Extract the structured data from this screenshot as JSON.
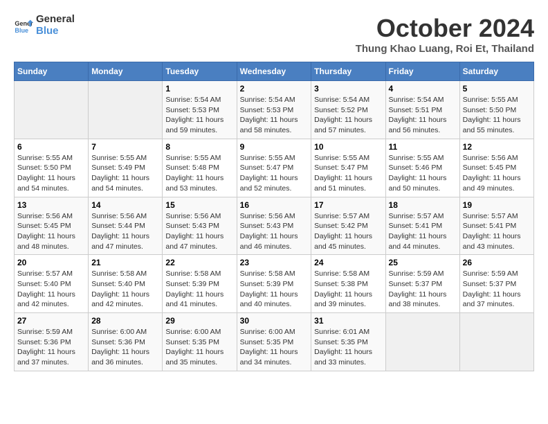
{
  "header": {
    "logo_line1": "General",
    "logo_line2": "Blue",
    "month": "October 2024",
    "location": "Thung Khao Luang, Roi Et, Thailand"
  },
  "weekdays": [
    "Sunday",
    "Monday",
    "Tuesday",
    "Wednesday",
    "Thursday",
    "Friday",
    "Saturday"
  ],
  "weeks": [
    [
      {
        "day": "",
        "info": ""
      },
      {
        "day": "",
        "info": ""
      },
      {
        "day": "1",
        "info": "Sunrise: 5:54 AM\nSunset: 5:53 PM\nDaylight: 11 hours and 59 minutes."
      },
      {
        "day": "2",
        "info": "Sunrise: 5:54 AM\nSunset: 5:53 PM\nDaylight: 11 hours and 58 minutes."
      },
      {
        "day": "3",
        "info": "Sunrise: 5:54 AM\nSunset: 5:52 PM\nDaylight: 11 hours and 57 minutes."
      },
      {
        "day": "4",
        "info": "Sunrise: 5:54 AM\nSunset: 5:51 PM\nDaylight: 11 hours and 56 minutes."
      },
      {
        "day": "5",
        "info": "Sunrise: 5:55 AM\nSunset: 5:50 PM\nDaylight: 11 hours and 55 minutes."
      }
    ],
    [
      {
        "day": "6",
        "info": "Sunrise: 5:55 AM\nSunset: 5:50 PM\nDaylight: 11 hours and 54 minutes."
      },
      {
        "day": "7",
        "info": "Sunrise: 5:55 AM\nSunset: 5:49 PM\nDaylight: 11 hours and 54 minutes."
      },
      {
        "day": "8",
        "info": "Sunrise: 5:55 AM\nSunset: 5:48 PM\nDaylight: 11 hours and 53 minutes."
      },
      {
        "day": "9",
        "info": "Sunrise: 5:55 AM\nSunset: 5:47 PM\nDaylight: 11 hours and 52 minutes."
      },
      {
        "day": "10",
        "info": "Sunrise: 5:55 AM\nSunset: 5:47 PM\nDaylight: 11 hours and 51 minutes."
      },
      {
        "day": "11",
        "info": "Sunrise: 5:55 AM\nSunset: 5:46 PM\nDaylight: 11 hours and 50 minutes."
      },
      {
        "day": "12",
        "info": "Sunrise: 5:56 AM\nSunset: 5:45 PM\nDaylight: 11 hours and 49 minutes."
      }
    ],
    [
      {
        "day": "13",
        "info": "Sunrise: 5:56 AM\nSunset: 5:45 PM\nDaylight: 11 hours and 48 minutes."
      },
      {
        "day": "14",
        "info": "Sunrise: 5:56 AM\nSunset: 5:44 PM\nDaylight: 11 hours and 47 minutes."
      },
      {
        "day": "15",
        "info": "Sunrise: 5:56 AM\nSunset: 5:43 PM\nDaylight: 11 hours and 47 minutes."
      },
      {
        "day": "16",
        "info": "Sunrise: 5:56 AM\nSunset: 5:43 PM\nDaylight: 11 hours and 46 minutes."
      },
      {
        "day": "17",
        "info": "Sunrise: 5:57 AM\nSunset: 5:42 PM\nDaylight: 11 hours and 45 minutes."
      },
      {
        "day": "18",
        "info": "Sunrise: 5:57 AM\nSunset: 5:41 PM\nDaylight: 11 hours and 44 minutes."
      },
      {
        "day": "19",
        "info": "Sunrise: 5:57 AM\nSunset: 5:41 PM\nDaylight: 11 hours and 43 minutes."
      }
    ],
    [
      {
        "day": "20",
        "info": "Sunrise: 5:57 AM\nSunset: 5:40 PM\nDaylight: 11 hours and 42 minutes."
      },
      {
        "day": "21",
        "info": "Sunrise: 5:58 AM\nSunset: 5:40 PM\nDaylight: 11 hours and 42 minutes."
      },
      {
        "day": "22",
        "info": "Sunrise: 5:58 AM\nSunset: 5:39 PM\nDaylight: 11 hours and 41 minutes."
      },
      {
        "day": "23",
        "info": "Sunrise: 5:58 AM\nSunset: 5:39 PM\nDaylight: 11 hours and 40 minutes."
      },
      {
        "day": "24",
        "info": "Sunrise: 5:58 AM\nSunset: 5:38 PM\nDaylight: 11 hours and 39 minutes."
      },
      {
        "day": "25",
        "info": "Sunrise: 5:59 AM\nSunset: 5:37 PM\nDaylight: 11 hours and 38 minutes."
      },
      {
        "day": "26",
        "info": "Sunrise: 5:59 AM\nSunset: 5:37 PM\nDaylight: 11 hours and 37 minutes."
      }
    ],
    [
      {
        "day": "27",
        "info": "Sunrise: 5:59 AM\nSunset: 5:36 PM\nDaylight: 11 hours and 37 minutes."
      },
      {
        "day": "28",
        "info": "Sunrise: 6:00 AM\nSunset: 5:36 PM\nDaylight: 11 hours and 36 minutes."
      },
      {
        "day": "29",
        "info": "Sunrise: 6:00 AM\nSunset: 5:35 PM\nDaylight: 11 hours and 35 minutes."
      },
      {
        "day": "30",
        "info": "Sunrise: 6:00 AM\nSunset: 5:35 PM\nDaylight: 11 hours and 34 minutes."
      },
      {
        "day": "31",
        "info": "Sunrise: 6:01 AM\nSunset: 5:35 PM\nDaylight: 11 hours and 33 minutes."
      },
      {
        "day": "",
        "info": ""
      },
      {
        "day": "",
        "info": ""
      }
    ]
  ]
}
